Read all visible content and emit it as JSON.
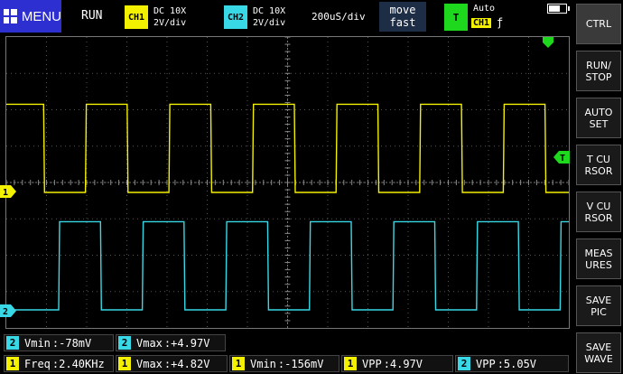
{
  "menu": {
    "label": "MENU"
  },
  "status": {
    "run": "RUN"
  },
  "ch1": {
    "badge": "CH1",
    "coupling": "DC 10X",
    "scale": "2V/div",
    "color": "#f3f000",
    "marker": "1"
  },
  "ch2": {
    "badge": "CH2",
    "coupling": "DC 10X",
    "scale": "2V/div",
    "color": "#39d8e6",
    "marker": "2"
  },
  "timebase": "200uS/div",
  "move": {
    "line1": "move",
    "line2": "fast"
  },
  "trigger": {
    "badge": "T",
    "mode": "Auto",
    "source": "CH1",
    "edge": "ƒ",
    "marker": "T",
    "color": "#1ed81e"
  },
  "side_buttons": [
    {
      "id": "ctrl",
      "label": "CTRL"
    },
    {
      "id": "run-stop",
      "label": "RUN/\nSTOP"
    },
    {
      "id": "auto-set",
      "label": "AUTO\nSET"
    },
    {
      "id": "t-cursor",
      "label": "T CU\nRSOR"
    },
    {
      "id": "v-cursor",
      "label": "V CU\nRSOR"
    },
    {
      "id": "measures",
      "label": "MEAS\nURES"
    },
    {
      "id": "save-pic",
      "label": "SAVE\nPIC"
    },
    {
      "id": "save-wave",
      "label": "SAVE\nWAVE"
    }
  ],
  "measurements_row1": [
    {
      "ch": "2",
      "name": "Vmin",
      "value": ":-78mV"
    },
    {
      "ch": "2",
      "name": "Vmax",
      "value": ":+4.97V"
    }
  ],
  "measurements_row2": [
    {
      "ch": "1",
      "name": "Freq",
      "value": ":2.40KHz"
    },
    {
      "ch": "1",
      "name": "Vmax",
      "value": ":+4.82V"
    },
    {
      "ch": "1",
      "name": "Vmin",
      "value": ":-156mV"
    },
    {
      "ch": "1",
      "name": "VPP",
      "value": ":4.97V"
    },
    {
      "ch": "2",
      "name": "VPP",
      "value": ":5.05V"
    }
  ],
  "chart_data": {
    "type": "line",
    "grid_divisions": {
      "x": 14,
      "y": 8
    },
    "series": [
      {
        "name": "CH1",
        "high_v": 4.82,
        "low_v": -0.156,
        "frequency_hz": 2400
      },
      {
        "name": "CH2",
        "high_v": 4.97,
        "low_v": -0.078
      }
    ]
  }
}
